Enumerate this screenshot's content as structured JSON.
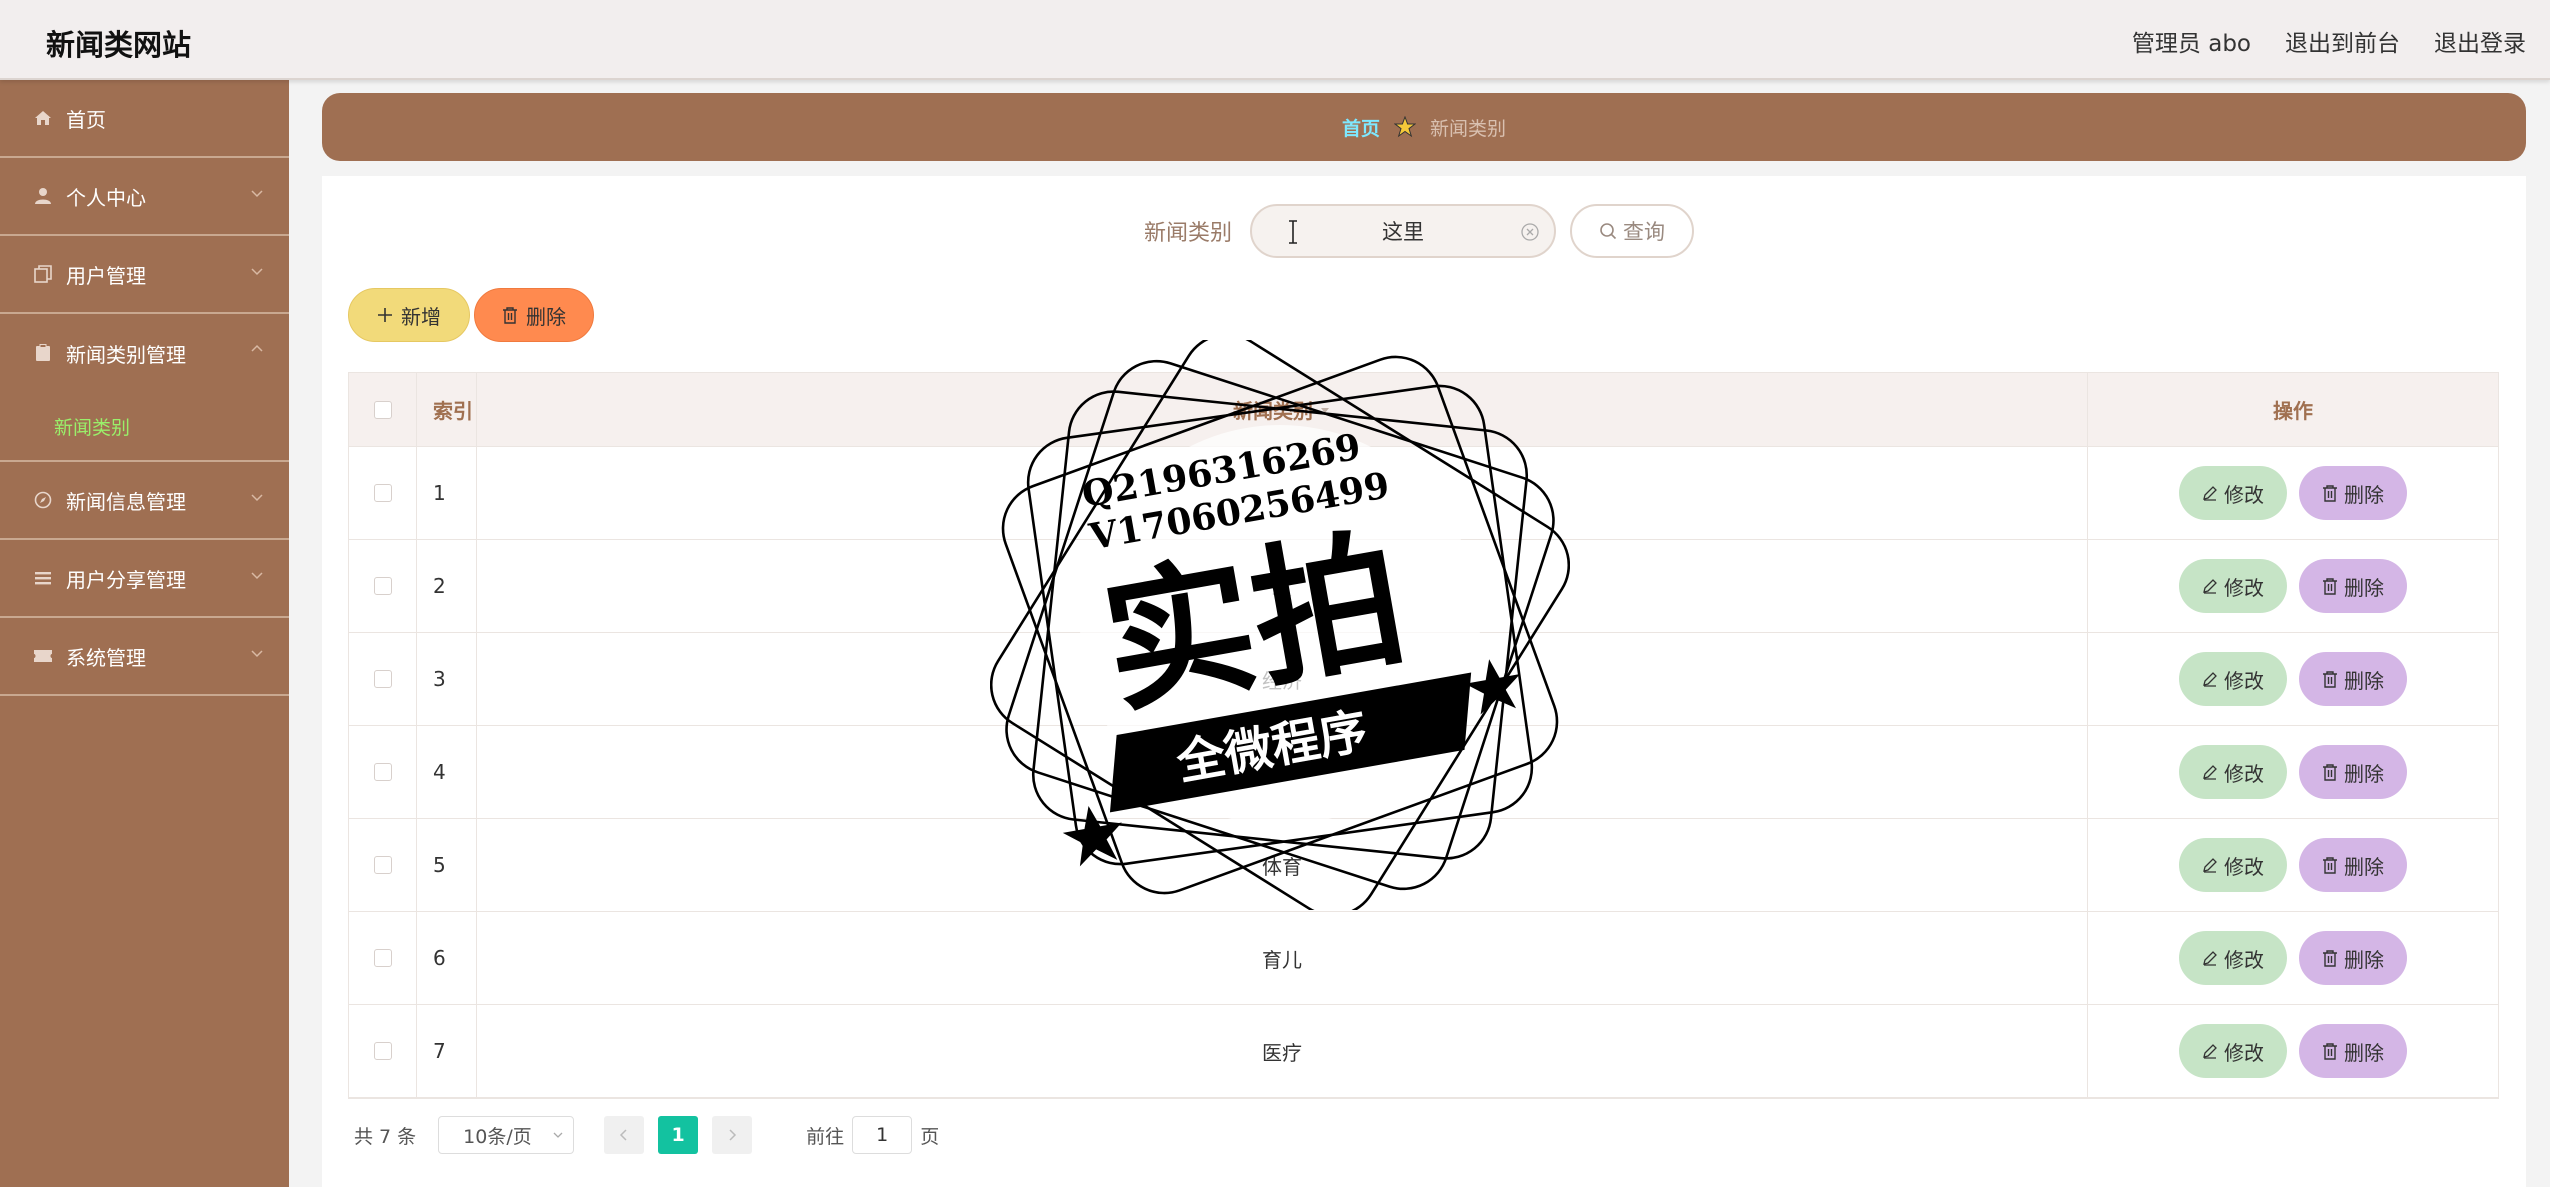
{
  "header": {
    "site_title": "新闻类网站",
    "admin_label": "管理员 abo",
    "to_front_label": "退出到前台",
    "logout_label": "退出登录"
  },
  "sidebar": {
    "items": [
      {
        "label": "首页",
        "icon": "home-icon"
      },
      {
        "label": "个人中心",
        "icon": "user-icon"
      },
      {
        "label": "用户管理",
        "icon": "copy-icon"
      },
      {
        "label": "新闻类别管理",
        "icon": "clipboard-icon",
        "expanded": true,
        "children": [
          {
            "label": "新闻类别"
          }
        ]
      },
      {
        "label": "新闻信息管理",
        "icon": "compass-icon"
      },
      {
        "label": "用户分享管理",
        "icon": "list-icon"
      },
      {
        "label": "系统管理",
        "icon": "ticket-icon"
      }
    ]
  },
  "breadcrumb": {
    "home": "首页",
    "current": "新闻类别"
  },
  "search": {
    "label": "新闻类别",
    "value": "这里",
    "button_label": "查询"
  },
  "actions": {
    "add_label": "新增",
    "delete_label": "删除"
  },
  "table": {
    "headers": {
      "index": "索引",
      "name": "新闻类别",
      "ops": "操作"
    },
    "edit_label": "修改",
    "delete_label": "删除",
    "rows": [
      {
        "index": "1",
        "name": ""
      },
      {
        "index": "2",
        "name": "政"
      },
      {
        "index": "3",
        "name": "经济"
      },
      {
        "index": "4",
        "name": ""
      },
      {
        "index": "5",
        "name": "体育"
      },
      {
        "index": "6",
        "name": "育儿"
      },
      {
        "index": "7",
        "name": "医疗"
      }
    ]
  },
  "pagination": {
    "total": "共 7 条",
    "page_size": "10条/页",
    "current_page": "1",
    "goto_prefix": "前往",
    "goto_value": "1",
    "goto_suffix": "页"
  },
  "watermark": {
    "line1": "Q2196316269",
    "line2": "V17060256499",
    "main": "实拍",
    "ribbon": "全微程序"
  },
  "colors": {
    "sidebar": "#9f6f52",
    "accent_green": "#13c2a0",
    "add_button": "#f2da7a",
    "delete_button": "#ff8a4f",
    "edit_button": "#c6e4c6",
    "row_delete_button": "#d4b6e6"
  }
}
